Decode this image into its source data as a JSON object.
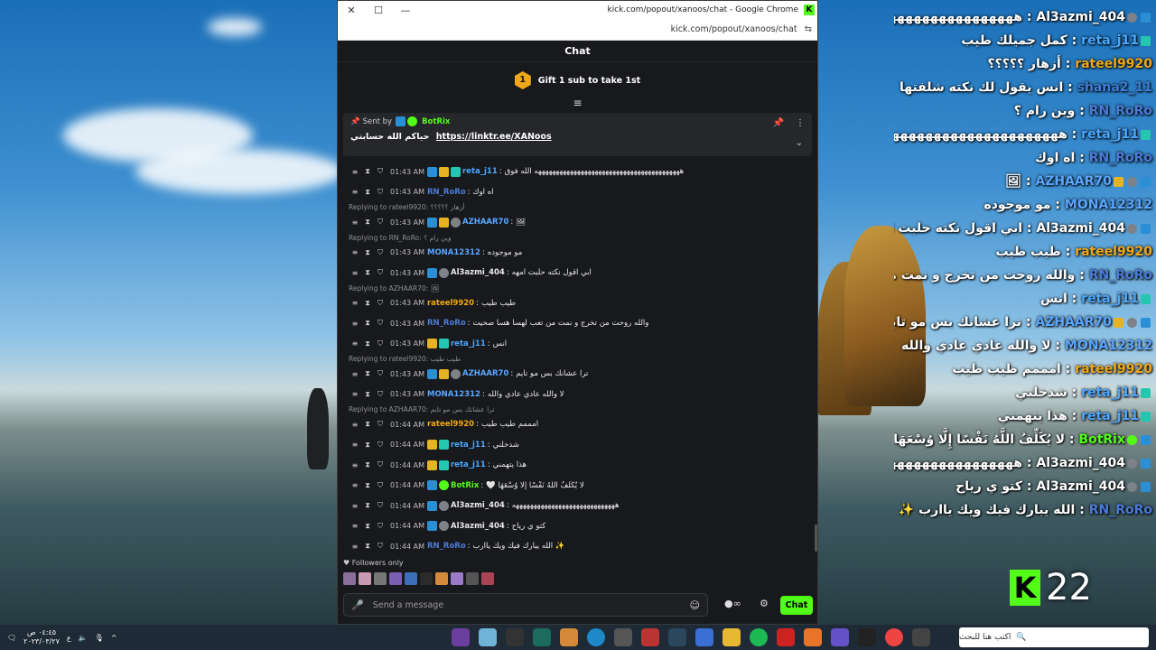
{
  "window": {
    "title": "kick.com/popout/xanoos/chat - Google Chrome",
    "url": "kick.com/popout/xanoos/chat",
    "controls": {
      "close": "✕",
      "maximize": "☐",
      "minimize": "—"
    }
  },
  "chat": {
    "header": "Chat",
    "gift_count": "1",
    "gift_text": "Gift 1 sub to take 1st",
    "pinned": {
      "sent_by": "Sent by",
      "bot": "BotRix",
      "message": "حياكم الله حسابتي",
      "link": "https://linktr.ee/XANoos"
    },
    "messages": [
      {
        "reply": "",
        "time": "01:43 AM",
        "badges": [
          "b-blue",
          "b-gold",
          "b-teal"
        ],
        "user": "reta_j11",
        "color": "#4aa8ff",
        "text": "هههههههههههههههههههههههههههههههههههههههههه الله فوق"
      },
      {
        "reply": "",
        "time": "01:43 AM",
        "badges": [],
        "user": "RN_RoRo",
        "color": "#4a7bd6",
        "text": "اه اوك"
      },
      {
        "reply": "Replying to rateel9920: أزهار ؟؟؟؟؟",
        "time": "01:43 AM",
        "badges": [
          "b-blue",
          "b-gold",
          "b-grey"
        ],
        "user": "AZHAAR70",
        "color": "#5aa6ff",
        "text": "🖼"
      },
      {
        "reply": "Replying to RN_RoRo: وين رام ؟",
        "time": "01:43 AM",
        "badges": [],
        "user": "MONA12312",
        "color": "#5aa6ff",
        "text": "مو موجوده"
      },
      {
        "reply": "",
        "time": "01:43 AM",
        "badges": [
          "b-blue",
          "b-grey"
        ],
        "user": "Al3azmi_404",
        "color": "#e8e8e8",
        "text": "ابي اقول نكته حلبت امهه"
      },
      {
        "reply": "Replying to AZHAAR70: 🖼",
        "time": "01:43 AM",
        "badges": [],
        "user": "rateel9920",
        "color": "#f0a818",
        "text": "طيب طيب"
      },
      {
        "reply": "",
        "time": "01:43 AM",
        "badges": [],
        "user": "RN_RoRo",
        "color": "#4a7bd6",
        "text": "والله روحت من تخرج و نمت من تعب لهسا هسا صحيت"
      },
      {
        "reply": "",
        "time": "01:43 AM",
        "badges": [
          "b-gold",
          "b-teal"
        ],
        "user": "reta_j11",
        "color": "#4aa8ff",
        "text": "انس"
      },
      {
        "reply": "Replying to rateel9920: طيب طيب",
        "time": "01:43 AM",
        "badges": [
          "b-blue",
          "b-gold",
          "b-grey"
        ],
        "user": "AZHAAR70",
        "color": "#5aa6ff",
        "text": "ترا عشانك بس مو تايم"
      },
      {
        "reply": "",
        "time": "01:43 AM",
        "badges": [],
        "user": "MONA12312",
        "color": "#5aa6ff",
        "text": "لا والله عادي عادي والله"
      },
      {
        "reply": "Replying to AZHAAR70: ترا عشانك بس مو تايم",
        "time": "01:44 AM",
        "badges": [],
        "user": "rateel9920",
        "color": "#f0a818",
        "text": "امممم طيب طيب"
      },
      {
        "reply": "",
        "time": "01:44 AM",
        "badges": [
          "b-gold",
          "b-teal"
        ],
        "user": "reta_j11",
        "color": "#4aa8ff",
        "text": "شدخلني"
      },
      {
        "reply": "",
        "time": "01:44 AM",
        "badges": [
          "b-gold",
          "b-teal"
        ],
        "user": "reta_j11",
        "color": "#4aa8ff",
        "text": "هذا يتهمني"
      },
      {
        "reply": "",
        "time": "01:44 AM",
        "badges": [
          "b-blue",
          "b-green"
        ],
        "user": "BotRix",
        "color": "#53fc18",
        "text": "لا يُكَلِّفُ اللَّهُ نَفْسًا إِلَّا وُسْعَهَا 🤍"
      },
      {
        "reply": "",
        "time": "01:44 AM",
        "badges": [
          "b-blue",
          "b-grey"
        ],
        "user": "Al3azmi_404",
        "color": "#e8e8e8",
        "text": "هههههههههههههههههههههههههههههه"
      },
      {
        "reply": "",
        "time": "01:44 AM",
        "badges": [
          "b-blue",
          "b-grey"
        ],
        "user": "Al3azmi_404",
        "color": "#e8e8e8",
        "text": "كتو ي رياح"
      },
      {
        "reply": "",
        "time": "01:44 AM",
        "badges": [],
        "user": "RN_RoRo",
        "color": "#4a7bd6",
        "text": "✨ الله يبارك فيك ويك ياارب"
      }
    ],
    "followers_only": "Followers only",
    "input_placeholder": "Send a message",
    "chat_button": "Chat"
  },
  "overlay": [
    {
      "user": "Al3azmi_404",
      "color": "#ffffff",
      "badges": [
        "b-blue",
        "b-grey"
      ],
      "text": "هههههههههههههههههههههههههههههه"
    },
    {
      "user": "reta_j11",
      "color": "#4aa8ff",
      "badges": [
        "b-teal"
      ],
      "text": "كمل جميلك طيب"
    },
    {
      "user": "rateel9920",
      "color": "#f0a818",
      "badges": [],
      "text": "أزهار ؟؟؟؟؟"
    },
    {
      "user": "shana2_11",
      "color": "#3b7dd8",
      "badges": [],
      "text": "انس يقول لك نكته شلفتها"
    },
    {
      "user": "RN_RoRo",
      "color": "#4a7bd6",
      "badges": [],
      "text": "وين رام ؟"
    },
    {
      "user": "reta_j11",
      "color": "#4aa8ff",
      "badges": [
        "b-teal"
      ],
      "text": "هههههههههههههههههههههههههه الله فوق"
    },
    {
      "user": "RN_RoRo",
      "color": "#4a7bd6",
      "badges": [],
      "text": "اه اوك"
    },
    {
      "user": "AZHAAR70",
      "color": "#5aa6ff",
      "badges": [
        "b-blue",
        "b-grey",
        "b-gold"
      ],
      "text": "🖼"
    },
    {
      "user": "MONA12312",
      "color": "#5aa6ff",
      "badges": [],
      "text": "مو موجوده"
    },
    {
      "user": "Al3azmi_404",
      "color": "#ffffff",
      "badges": [
        "b-blue",
        "b-grey"
      ],
      "text": "ابي اقول نكته حلبت امهه"
    },
    {
      "user": "rateel9920",
      "color": "#f0a818",
      "badges": [],
      "text": "طيب طيب"
    },
    {
      "user": "RN_RoRo",
      "color": "#4a7bd6",
      "badges": [],
      "text": "والله روحت من تخرج و نمت من تعب لهسا هسا صحيت"
    },
    {
      "user": "reta_j11",
      "color": "#4aa8ff",
      "badges": [
        "b-teal"
      ],
      "text": "انس"
    },
    {
      "user": "AZHAAR70",
      "color": "#5aa6ff",
      "badges": [
        "b-blue",
        "b-grey",
        "b-gold"
      ],
      "text": "ترا عشانك بس مو تايم"
    },
    {
      "user": "MONA12312",
      "color": "#5aa6ff",
      "badges": [],
      "text": "لا والله عادي عادي والله"
    },
    {
      "user": "rateel9920",
      "color": "#f0a818",
      "badges": [],
      "text": "امممم طيب طيب"
    },
    {
      "user": "reta_j11",
      "color": "#4aa8ff",
      "badges": [
        "b-teal"
      ],
      "text": "شدخلني"
    },
    {
      "user": "reta_j11",
      "color": "#4aa8ff",
      "badges": [
        "b-teal"
      ],
      "text": "هذا يتهمني"
    },
    {
      "user": "BotRix",
      "color": "#53fc18",
      "badges": [
        "b-blue",
        "b-green"
      ],
      "text": "لا يُكَلِّفُ اللَّهُ نَفْسًا إِلَّا وُسْعَهَا 🤍"
    },
    {
      "user": "Al3azmi_404",
      "color": "#ffffff",
      "badges": [
        "b-blue",
        "b-grey"
      ],
      "text": "هههههههههههههههههههههههههههههه"
    },
    {
      "user": "Al3azmi_404",
      "color": "#ffffff",
      "badges": [
        "b-blue",
        "b-grey"
      ],
      "text": "كتو ي رياح"
    },
    {
      "user": "RN_RoRo",
      "color": "#4a7bd6",
      "badges": [],
      "text": "الله يبارك فيك ويك ياارب ✨"
    }
  ],
  "kick_counter": {
    "logo": "K",
    "count": "22"
  },
  "taskbar": {
    "time": "٠٤:٤٥ ص",
    "date": "٢٠٢٣/٠٣/٢٧",
    "lang": "ع",
    "search_placeholder": "اكتب هنا للبحث"
  }
}
